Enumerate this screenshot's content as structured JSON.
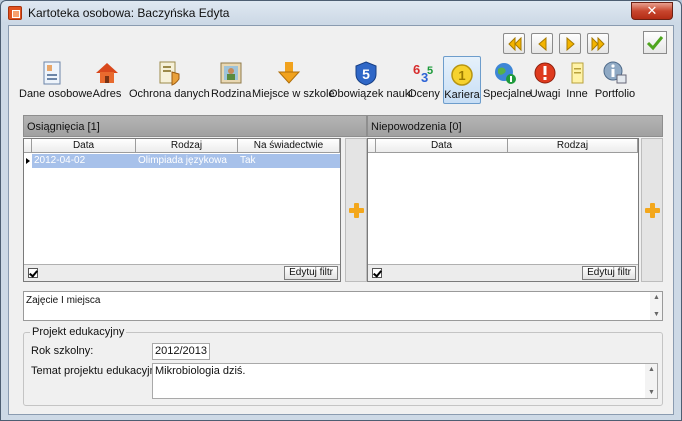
{
  "window": {
    "title": "Kartoteka osobowa: Baczyńska Edyta",
    "close_glyph": "✕"
  },
  "nav": {
    "buttons": [
      {
        "icon": "first-record-icon"
      },
      {
        "icon": "previous-record-icon"
      },
      {
        "icon": "next-record-icon"
      },
      {
        "icon": "last-record-icon"
      }
    ],
    "confirm_icon": "checkmark-icon"
  },
  "toolbar": {
    "items": [
      {
        "label": "Dane osobowe",
        "icon": "id-card-icon",
        "active": false
      },
      {
        "label": "Adres",
        "icon": "house-icon",
        "active": false
      },
      {
        "label": "Ochrona danych",
        "icon": "shield-document-icon",
        "active": false
      },
      {
        "label": "Rodzina",
        "icon": "family-picture-icon",
        "active": false
      },
      {
        "label": "Miejsce w szkole",
        "icon": "arrow-down-icon",
        "active": false
      },
      {
        "label": "Obowiązek nauki",
        "icon": "number-five-icon",
        "active": false
      },
      {
        "label": "Oceny",
        "icon": "grades-icon",
        "active": false
      },
      {
        "label": "Kariera",
        "icon": "medal-icon",
        "active": true
      },
      {
        "label": "Specjalne",
        "icon": "globe-icon",
        "active": false
      },
      {
        "label": "Uwagi",
        "icon": "warning-icon",
        "active": false
      },
      {
        "label": "Inne",
        "icon": "note-icon",
        "active": false
      },
      {
        "label": "Portfolio",
        "icon": "info-portfolio-icon",
        "active": false
      }
    ]
  },
  "achievements": {
    "header": "Osiągnięcia [1]",
    "columns": [
      "Data",
      "Rodzaj",
      "Na świadectwie"
    ],
    "rows": [
      {
        "date": "2012-04-02",
        "type": "Olimpiada językowa",
        "on_certificate": "Tak"
      }
    ],
    "filter_label": "Edytuj filtr",
    "filter_checked": true
  },
  "failures": {
    "header": "Niepowodzenia [0]",
    "columns": [
      "Data",
      "Rodzaj"
    ],
    "rows": [],
    "filter_label": "Edytuj filtr",
    "filter_checked": true
  },
  "details_memo": "Zajęcie I miejsca",
  "project": {
    "legend": "Projekt edukacyjny",
    "school_year_label": "Rok szkolny:",
    "school_year_value": "2012/2013",
    "topic_label": "Temat projektu edukacyjnego:",
    "topic_value": "Mikrobiologia dziś."
  },
  "colors": {
    "accent": "#f3a71c",
    "selection": "#a7c1ea",
    "active_tab": "#c7def5"
  }
}
